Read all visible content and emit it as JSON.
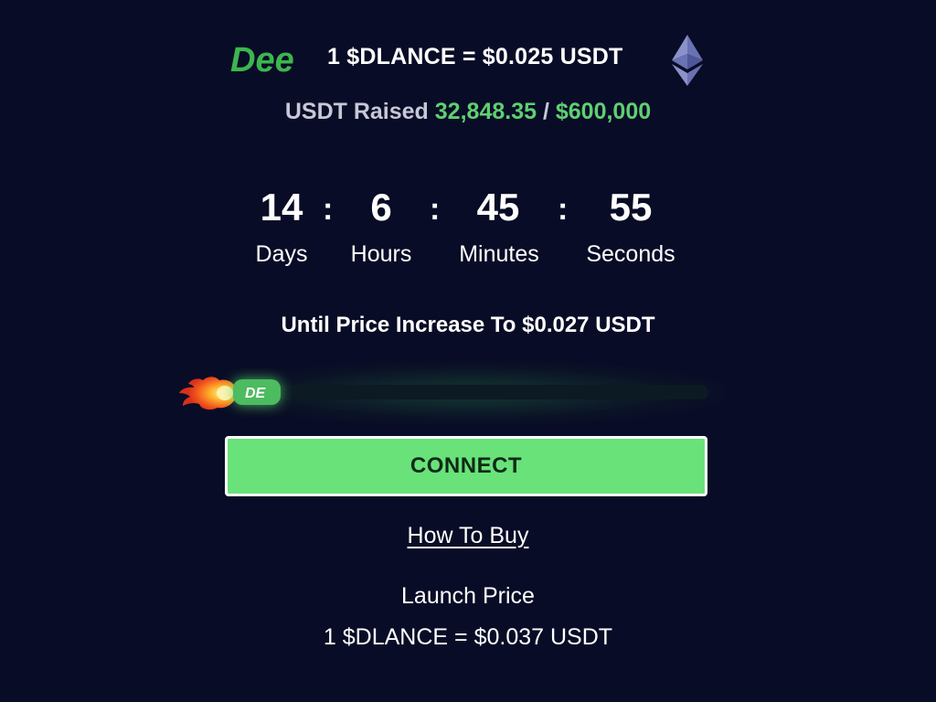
{
  "header": {
    "logo_text": "Dee",
    "price_line": "1 $DLANCE = $0.025 USDT",
    "network_icon": "ethereum-icon"
  },
  "raised": {
    "label": "USDT Raised",
    "amount": "32,848.35",
    "separator": "/",
    "goal": "$600,000"
  },
  "countdown": {
    "days_value": "14",
    "days_label": "Days",
    "hours_value": "6",
    "hours_label": "Hours",
    "minutes_value": "45",
    "minutes_label": "Minutes",
    "seconds_value": "55",
    "seconds_label": "Seconds",
    "separator": ":"
  },
  "until_text": "Until Price Increase To $0.027 USDT",
  "progress": {
    "fraction": 0.055,
    "thumb_logo": "DE",
    "icon": "flame-icon"
  },
  "connect_label": "CONNECT",
  "how_to_buy_label": "How To Buy",
  "launch": {
    "label": "Launch Price",
    "value": "1 $DLANCE = $0.037 USDT"
  },
  "colors": {
    "background": "#090c26",
    "accent_green": "#5fcf72",
    "button_green": "#69e27a",
    "muted_text": "#c6c8d6"
  }
}
